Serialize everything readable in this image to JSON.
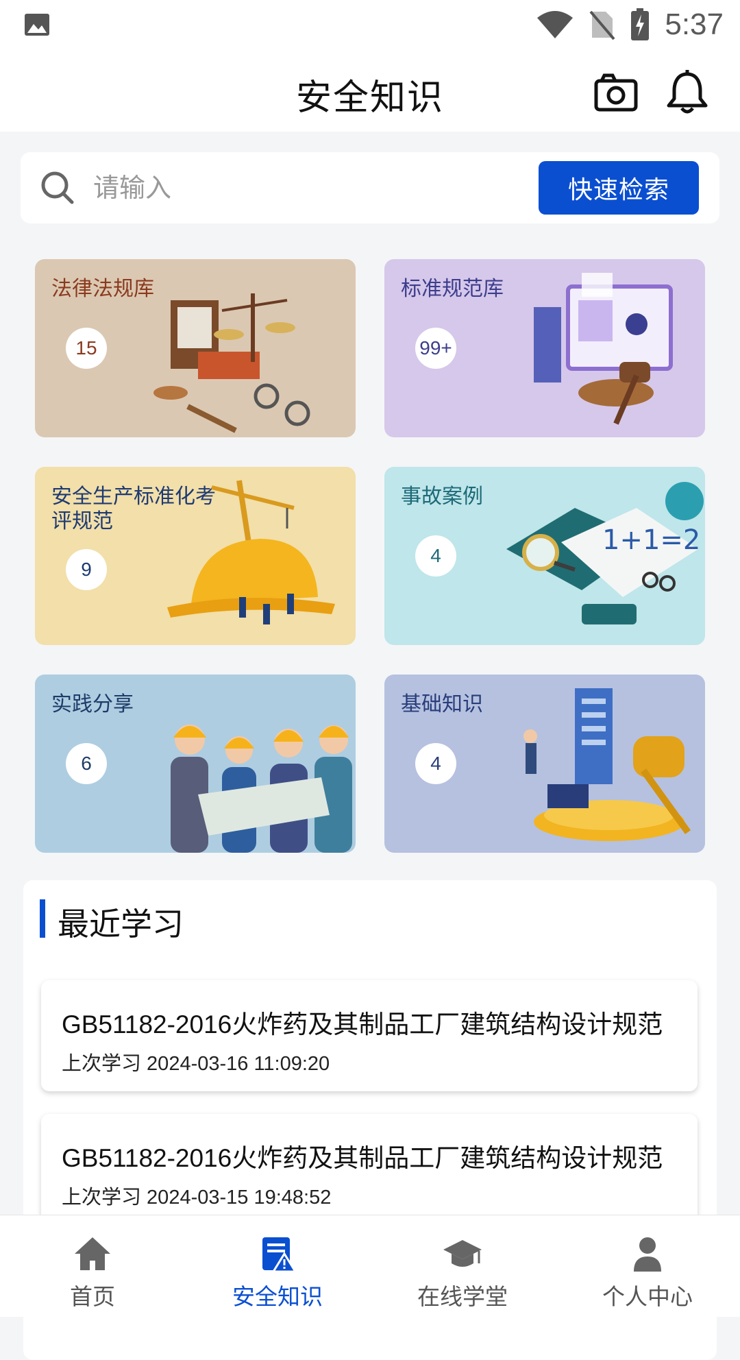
{
  "status_bar": {
    "time": "5:37",
    "icons": [
      "image-icon",
      "wifi-icon",
      "no-sim-icon",
      "battery-charging-icon"
    ]
  },
  "header": {
    "title": "安全知识",
    "icons": [
      "camera-icon",
      "bell-icon"
    ]
  },
  "search": {
    "placeholder": "请输入",
    "button_label": "快速检索"
  },
  "categories": [
    {
      "label": "法律法规库",
      "count": "15",
      "color": "#dbc8b2",
      "text_color": "#8a3a1e"
    },
    {
      "label": "标准规范库",
      "count": "99+",
      "color": "#d6c8ea",
      "text_color": "#3c3d8c"
    },
    {
      "label": "安全生产标准化考评规范",
      "count": "9",
      "color": "#f2dfa9",
      "text_color": "#1e3a73"
    },
    {
      "label": "事故案例",
      "count": "4",
      "color": "#bfe6ea",
      "text_color": "#1d6a78"
    },
    {
      "label": "实践分享",
      "count": "6",
      "color": "#aecde1",
      "text_color": "#1e3c68"
    },
    {
      "label": "基础知识",
      "count": "4",
      "color": "#b6c1e0",
      "text_color": "#283d7a"
    }
  ],
  "recent": {
    "title": "最近学习",
    "items": [
      {
        "title": "GB51182-2016火炸药及其制品工厂建筑结构设计规范",
        "meta": "上次学习 2024-03-16 11:09:20"
      },
      {
        "title": "GB51182-2016火炸药及其制品工厂建筑结构设计规范",
        "meta": "上次学习 2024-03-15 19:48:52"
      }
    ]
  },
  "bottom_nav": {
    "items": [
      {
        "label": "首页",
        "icon": "home-icon",
        "active": false
      },
      {
        "label": "安全知识",
        "icon": "knowledge-icon",
        "active": true
      },
      {
        "label": "在线学堂",
        "icon": "graduation-cap-icon",
        "active": false
      },
      {
        "label": "个人中心",
        "icon": "person-icon",
        "active": false
      }
    ]
  },
  "colors": {
    "accent": "#0b4fd1",
    "inactive_nav": "#555555"
  }
}
